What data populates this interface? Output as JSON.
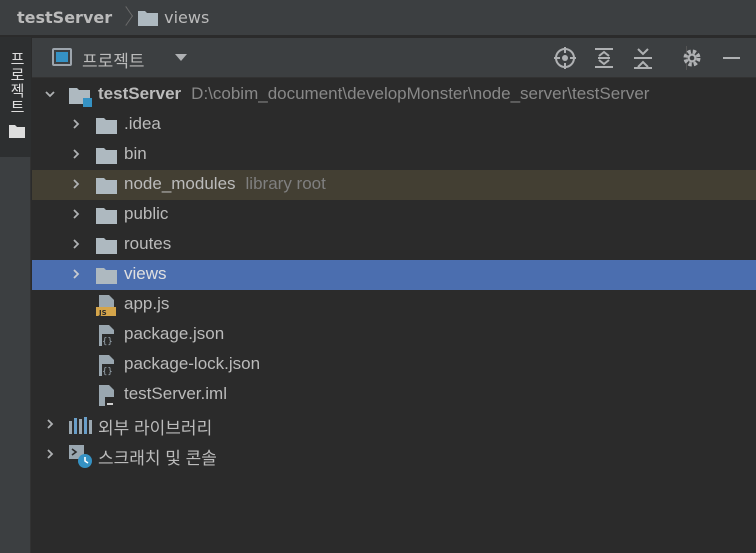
{
  "breadcrumb": {
    "root": "testServer",
    "current": "views"
  },
  "stripe": {
    "tab_label": "프로젝트"
  },
  "panel": {
    "title": "프로젝트"
  },
  "tree": {
    "root": {
      "name": "testServer",
      "path": "D:\\cobim_document\\developMonster\\node_server\\testServer"
    },
    "folders": [
      {
        "name": ".idea"
      },
      {
        "name": "bin"
      },
      {
        "name": "node_modules",
        "hint": "library root"
      },
      {
        "name": "public"
      },
      {
        "name": "routes"
      },
      {
        "name": "views",
        "selected": true
      }
    ],
    "files": [
      {
        "name": "app.js",
        "icon": "js-file-icon"
      },
      {
        "name": "package.json",
        "icon": "json-file-icon"
      },
      {
        "name": "package-lock.json",
        "icon": "json-file-icon"
      },
      {
        "name": "testServer.iml",
        "icon": "iml-file-icon"
      }
    ],
    "external_libraries": "외부 라이브러리",
    "scratches": "스크래치 및 콘솔"
  },
  "colors": {
    "background": "#2b2b2b",
    "toolbar": "#3c3f41",
    "selection": "#4b6eaf",
    "library_row": "#433f33",
    "folder": "#aeb9c0"
  }
}
